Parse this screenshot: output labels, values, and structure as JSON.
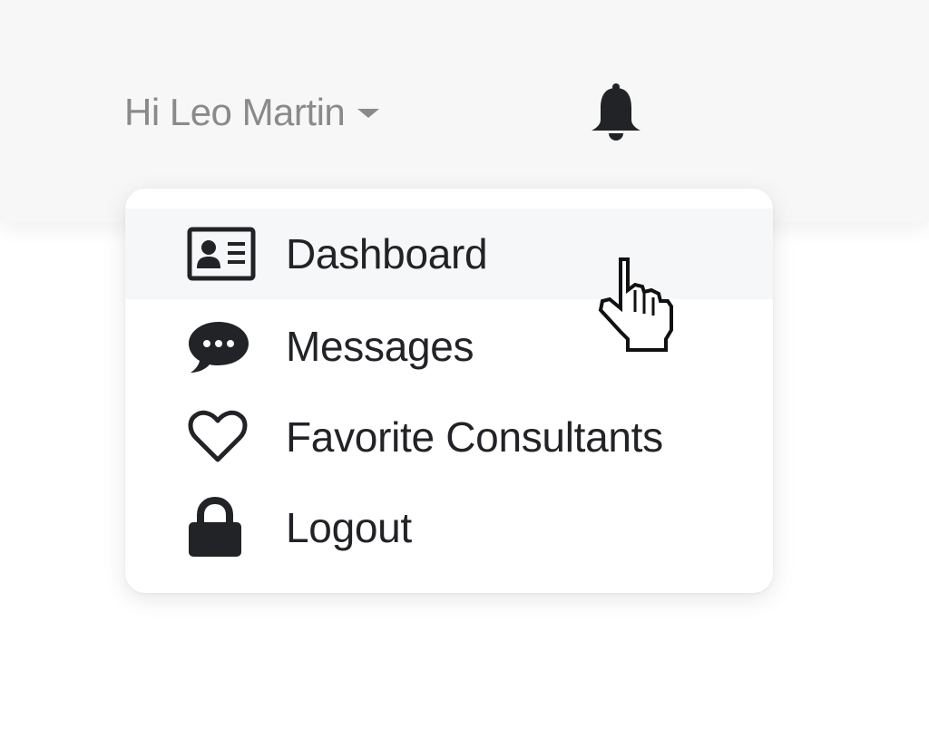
{
  "header": {
    "greeting": "Hi Leo Martin",
    "notification_icon": "bell-icon"
  },
  "menu": {
    "items": [
      {
        "label": "Dashboard",
        "icon": "id-card-icon",
        "active": true
      },
      {
        "label": "Messages",
        "icon": "chat-bubble-icon",
        "active": false
      },
      {
        "label": "Favorite Consultants",
        "icon": "heart-outline-icon",
        "active": false
      },
      {
        "label": "Logout",
        "icon": "lock-icon",
        "active": false
      }
    ]
  },
  "colors": {
    "text_dark": "#222326",
    "text_muted": "#8a8a8a",
    "header_bg": "#f7f7f7",
    "active_item_bg": "#f6f7f8"
  },
  "cursor": "pointer-hand-icon"
}
